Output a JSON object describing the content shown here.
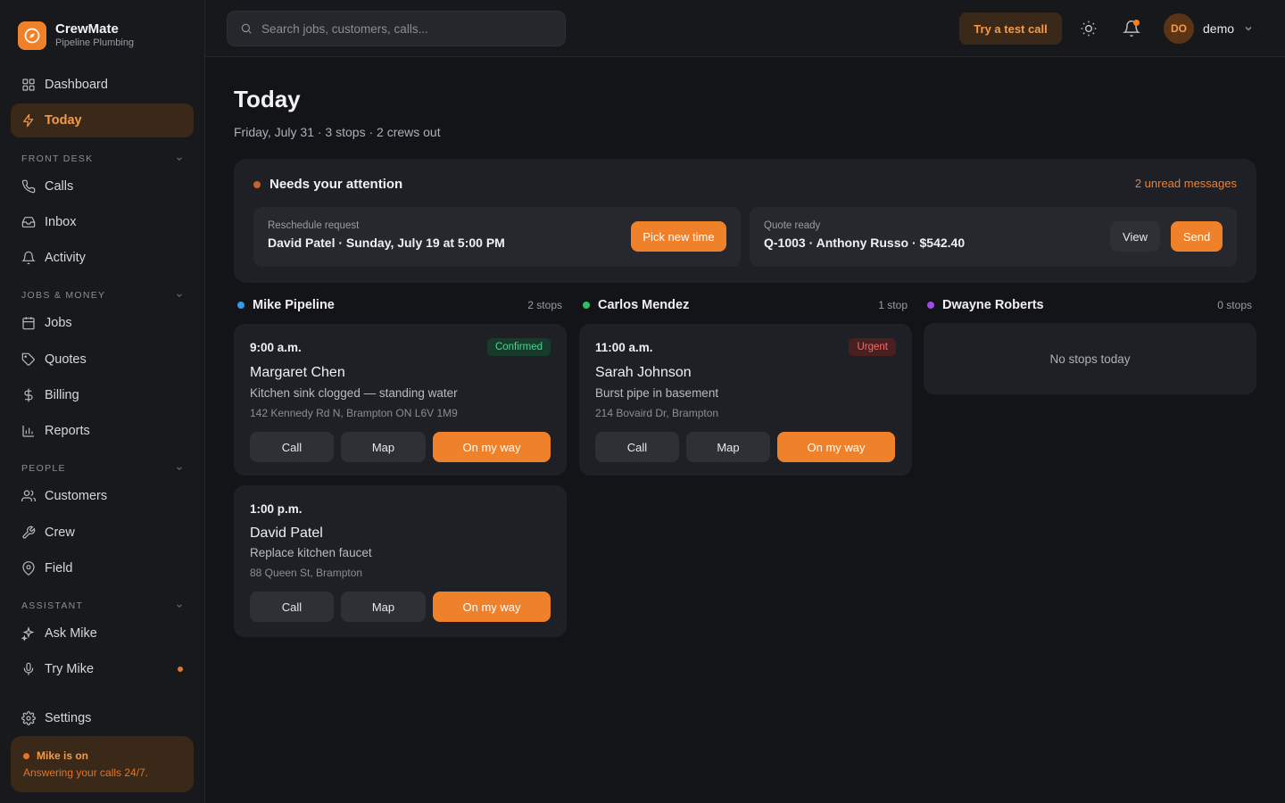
{
  "brand": {
    "name": "CrewMate",
    "subtitle": "Pipeline Plumbing"
  },
  "sidebar": {
    "top_items": [
      {
        "label": "Dashboard",
        "icon": "grid-icon"
      },
      {
        "label": "Today",
        "icon": "bolt-icon",
        "active": true
      }
    ],
    "sections": [
      {
        "title": "FRONT DESK",
        "items": [
          {
            "label": "Calls",
            "icon": "phone-icon"
          },
          {
            "label": "Inbox",
            "icon": "inbox-icon"
          },
          {
            "label": "Activity",
            "icon": "bell-icon"
          }
        ]
      },
      {
        "title": "JOBS & MONEY",
        "items": [
          {
            "label": "Jobs",
            "icon": "calendar-icon"
          },
          {
            "label": "Quotes",
            "icon": "tag-icon"
          },
          {
            "label": "Billing",
            "icon": "dollar-icon"
          },
          {
            "label": "Reports",
            "icon": "bar-chart-icon"
          }
        ]
      },
      {
        "title": "PEOPLE",
        "items": [
          {
            "label": "Customers",
            "icon": "users-icon"
          },
          {
            "label": "Crew",
            "icon": "wrench-icon"
          },
          {
            "label": "Field",
            "icon": "map-pin-icon"
          }
        ]
      },
      {
        "title": "ASSISTANT",
        "items": [
          {
            "label": "Ask Mike",
            "icon": "sparkles-icon"
          },
          {
            "label": "Try Mike",
            "icon": "microphone-icon",
            "dot": true
          }
        ]
      }
    ],
    "settings_label": "Settings",
    "status_card": {
      "title": "Mike is on",
      "subtitle": "Answering your calls 24/7."
    }
  },
  "topbar": {
    "search_placeholder": "Search jobs, customers, calls...",
    "test_call_label": "Try a test call",
    "user": {
      "initials": "DO",
      "name": "demo"
    }
  },
  "page": {
    "title": "Today",
    "subtitle": "Friday, July 31 · 3 stops · 2 crews out"
  },
  "attention": {
    "title": "Needs your attention",
    "link": "2 unread messages",
    "cards": [
      {
        "label": "Reschedule request",
        "value": "David Patel · Sunday, July 19 at 5:00 PM",
        "primary_action": "Pick new time"
      },
      {
        "label": "Quote ready",
        "value": "Q-1003 · Anthony Russo · $542.40",
        "secondary_action": "View",
        "primary_action": "Send"
      }
    ]
  },
  "crews": [
    {
      "name": "Mike Pipeline",
      "color": "#2f9be8",
      "count": "2 stops"
    },
    {
      "name": "Carlos Mendez",
      "color": "#2fbf5f",
      "count": "1 stop"
    },
    {
      "name": "Dwayne Roberts",
      "color": "#a04be8",
      "count": "0 stops"
    }
  ],
  "jobs": [
    {
      "time": "9:00 a.m.",
      "badge": "Confirmed",
      "customer": "Margaret Chen",
      "desc": "Kitchen sink clogged — standing water",
      "address": "142 Kennedy Rd N, Brampton ON L6V 1M9"
    },
    {
      "time": "1:00 p.m.",
      "customer": "David Patel",
      "desc": "Replace kitchen faucet",
      "address": "88 Queen St, Brampton"
    },
    {
      "time": "11:00 a.m.",
      "badge": "Urgent",
      "customer": "Sarah Johnson",
      "desc": "Burst pipe in basement",
      "address": "214 Bovaird Dr, Brampton"
    }
  ],
  "job_actions": {
    "call": "Call",
    "map": "Map",
    "on_my_way": "On my way"
  },
  "empty_state": "No stops today",
  "colors": {
    "accent": "#f0812b",
    "background": "#131418",
    "card": "#1e2025"
  }
}
